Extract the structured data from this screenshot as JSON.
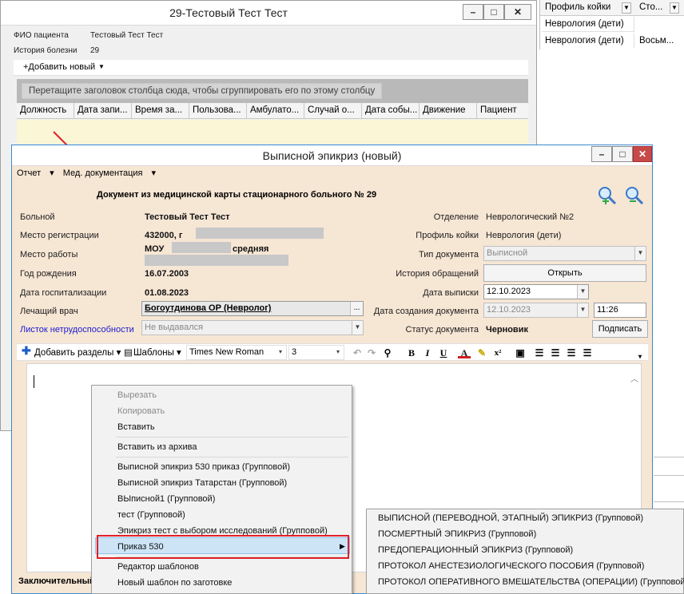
{
  "bg_window": {
    "title": "29-Тестовый Тест Тест",
    "fio_label": "ФИО пациента",
    "fio_value": "Тестовый Тест Тест",
    "history_label": "История болезни",
    "history_value": "29",
    "add_new": "+Добавить новый",
    "group_hint": "Перетащите заголовок столбца сюда, чтобы сгруппировать его по этому столбцу",
    "columns": [
      "Должность",
      "Дата запи...",
      "Время за...",
      "Пользова...",
      "Амбулато...",
      "Случай о...",
      "Дата собы...",
      "Движение",
      "Пациент"
    ]
  },
  "right_table": {
    "col1": "Профиль койки",
    "col2": "Сто...",
    "rows": [
      {
        "c1": "Неврология (дети)",
        "c2": ""
      },
      {
        "c1": "Неврология (дети)",
        "c2": "Восьм..."
      }
    ]
  },
  "dialog": {
    "title": "Выписной эпикриз (новый)",
    "menu": {
      "report": "Отчет",
      "med_docs": "Мед. документация"
    },
    "header": "Документ из медицинской карты стационарного больного № 29",
    "patient_label": "Больной",
    "patient_value": "Тестовый Тест Тест",
    "reg_label": "Место регистрации",
    "reg_value": "432000, г",
    "work_label": "Место работы",
    "work_value": "МОУ",
    "work_value_tail": "средняя",
    "birth_label": "Год рождения",
    "birth_value": "16.07.2003",
    "hosp_label": "Дата госпитализации",
    "hosp_value": "01.08.2023",
    "doctor_label": "Лечащий врач",
    "doctor_value": "Богоутдинова ОР (Невролог)",
    "sick_label": "Листок нетрудоспособности",
    "sick_value": "Не выдавался",
    "dept_label": "Отделение",
    "dept_value": "Неврологический №2",
    "bed_label": "Профиль койки",
    "bed_value": "Неврология (дети)",
    "doctype_label": "Тип документа",
    "doctype_value": "Выписной",
    "history_label": "История обращений",
    "open_button": "Открыть",
    "discharge_label": "Дата выписки",
    "discharge_value": "12.10.2023",
    "created_label": "Дата создания документа",
    "created_date": "12.10.2023",
    "created_time": "11:26",
    "status_label": "Статус документа",
    "status_value": "Черновик",
    "sign_button": "Подписать",
    "closing_label": "Заключительный"
  },
  "editor_toolbar": {
    "add_sections": "Добавить разделы",
    "templates": "Шаблоны",
    "font": "Times New Roman",
    "size": "3"
  },
  "context_menu": {
    "items": [
      "Вырезать",
      "Копировать",
      "Вставить",
      "Вставить из архива",
      "Выписной эпикриз 530 приказ (Групповой)",
      "Выписной эпикриз Татарстан (Групповой)",
      "ВЫписной1 (Групповой)",
      "тест (Групповой)",
      "Эпикриз тест с выбором исследований (Групповой)",
      "Приказ 530",
      "Редактор шаблонов",
      "Новый шаблон по заготовке"
    ]
  },
  "submenu": {
    "items": [
      "ВЫПИСНОЙ (ПЕРЕВОДНОЙ, ЭТАПНЫЙ)  ЭПИКРИЗ (Групповой)",
      "ПОСМЕРТНЫЙ ЭПИКРИЗ (Групповой)",
      "ПРЕДОПЕРАЦИОННЫЙ ЭПИКРИЗ (Групповой)",
      "ПРОТОКОЛ АНЕСТЕЗИОЛОГИЧЕСКОГО ПОСОБИЯ (Групповой)",
      "ПРОТОКОЛ ОПЕРАТИВНОГО ВМЕШАТЕЛЬСТВА (ОПЕРАЦИИ) (Групповой)"
    ]
  },
  "colors": {
    "dialog_bg": "#f6e6d4",
    "highlight": "#cde4f7",
    "annotation_red": "#e0212a"
  }
}
